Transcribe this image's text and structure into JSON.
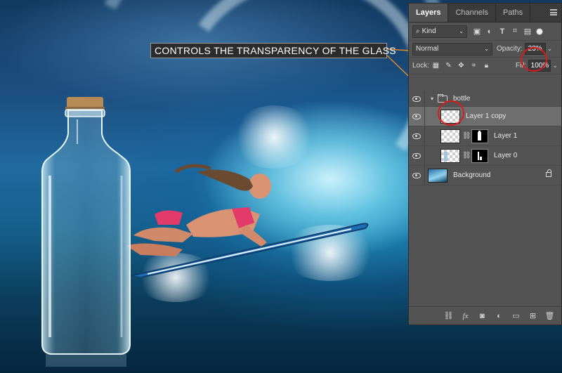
{
  "callout": {
    "text": "CONTROLS THE TRANSPARENCY OF THE GLASS"
  },
  "panel": {
    "tabs": [
      {
        "label": "Layers",
        "active": true
      },
      {
        "label": "Channels",
        "active": false
      },
      {
        "label": "Paths",
        "active": false
      }
    ],
    "filter": {
      "kind_label": "Kind",
      "icons": [
        "image-filter-icon",
        "adjustment-filter-icon",
        "type-filter-icon",
        "shape-filter-icon",
        "smart-object-filter-icon"
      ]
    },
    "blend_mode": "Normal",
    "opacity_label": "Opacity:",
    "opacity_value": "23%",
    "lock_label": "Lock:",
    "fill_label": "Fill:",
    "fill_value": "100%",
    "layers": [
      {
        "name": "bottle",
        "type": "group",
        "visible": true
      },
      {
        "name": "Layer 1 copy",
        "type": "layer",
        "visible": true,
        "selected": true
      },
      {
        "name": "Layer 1",
        "type": "layer-with-mask",
        "visible": true
      },
      {
        "name": "Layer 0",
        "type": "layer-with-mask",
        "visible": true
      },
      {
        "name": "Background",
        "type": "background",
        "visible": true,
        "locked": true
      }
    ],
    "bottom_icons": [
      "link-layers-icon",
      "fx-icon",
      "add-mask-icon",
      "adjustment-layer-icon",
      "new-group-icon",
      "new-layer-icon",
      "delete-layer-icon"
    ],
    "fx_label": "fx"
  },
  "colors": {
    "panel_bg": "#535353",
    "highlight_red": "#d81c1c",
    "callout_line": "#e08a2a"
  }
}
